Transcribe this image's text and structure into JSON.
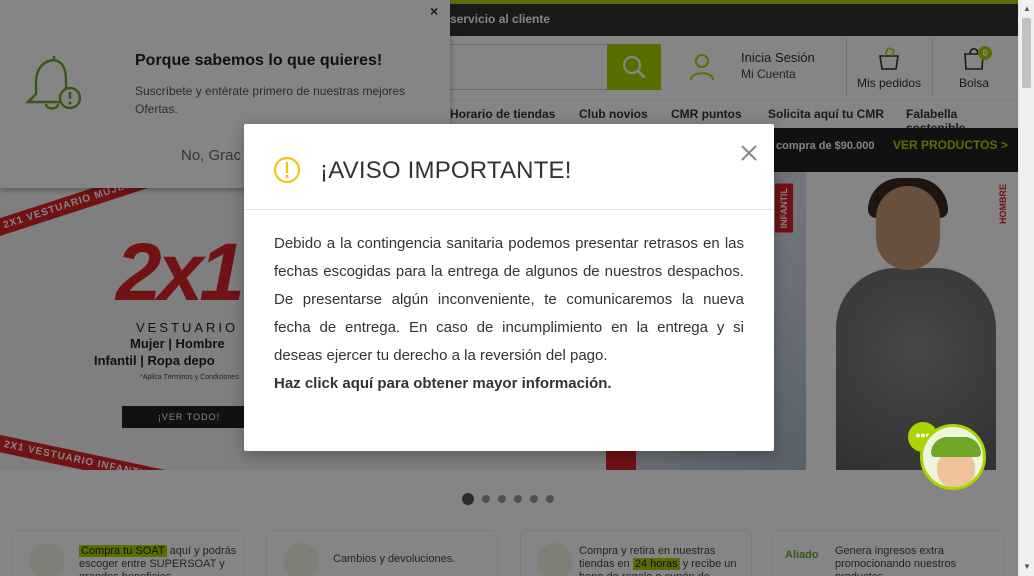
{
  "header": {
    "topbar_link": "servicio al cliente",
    "login_title": "Inicia Sesión",
    "login_sub": "Mi Cuenta",
    "orders_label": "Mis pedidos",
    "bag_label": "Bolsa",
    "bag_count": "0"
  },
  "nav": {
    "items": [
      "Horario de tiendas",
      "Club novios",
      "CMR puntos",
      "Solicita aquí tu CMR",
      "Falabella sostenible"
    ]
  },
  "promo": {
    "text": "compra de $90.000",
    "cta": "VER PRODUCTOS >"
  },
  "hero": {
    "ribbon_top": "2X1 VESTUARIO MUJER, H",
    "ribbon_bottom": "2X1 VESTUARIO INFANTIL, ROPA DEPORTIVA 2X1 VESTU",
    "big": "2x1",
    "vestuario": "VESTUARIO",
    "cat1": "Mujer | Hombre",
    "cat2": "Infantil | Ropa depo",
    "terms": "*Aplica Términos y Condiciones",
    "cta": "¡VER TODO!",
    "label_infantil": "INFANTIL",
    "label_hombre": "HOMBRE"
  },
  "carousel": {
    "count": 6,
    "active": 1
  },
  "cards": [
    {
      "highlight": "Compra tu SOAT",
      "text": " aquí y podrás escoger entre SUPERSOAT y grandes beneficios"
    },
    {
      "highlight": "",
      "text": "Cambios y devoluciones."
    },
    {
      "pre": "Compra y retira en nuestras tiendas en ",
      "highlight": "24 horas",
      "text": " y recibe un bono de regalo o cupón de descuento"
    },
    {
      "badge": "Aliado",
      "highlight": "",
      "text": "Genera ingresos extra promocionando nuestros productos"
    }
  ],
  "notification": {
    "title": "Porque sabemos lo que quieres!",
    "description": "Suscríbete y entérate primero de nuestras mejores Ofertas.",
    "decline": "No, Grac",
    "close": "×"
  },
  "modal": {
    "title": "¡AVISO IMPORTANTE!",
    "body": "Debido a la contingencia sanitaria podemos presentar retrasos en las fechas escogidas para la entrega de algunos de nuestros despachos. De presentarse algún inconveniente, te comunicaremos la nueva fecha de entrega. En caso de incumplimiento en la entrega y si deseas ejercer tu derecho a la reversión del pago.",
    "link": "Haz click aquí para obtener mayor información."
  },
  "chat": {
    "bubble": "•••"
  },
  "colors": {
    "accent": "#aad500",
    "brand_red": "#d9232a",
    "warning": "#f0c419"
  }
}
